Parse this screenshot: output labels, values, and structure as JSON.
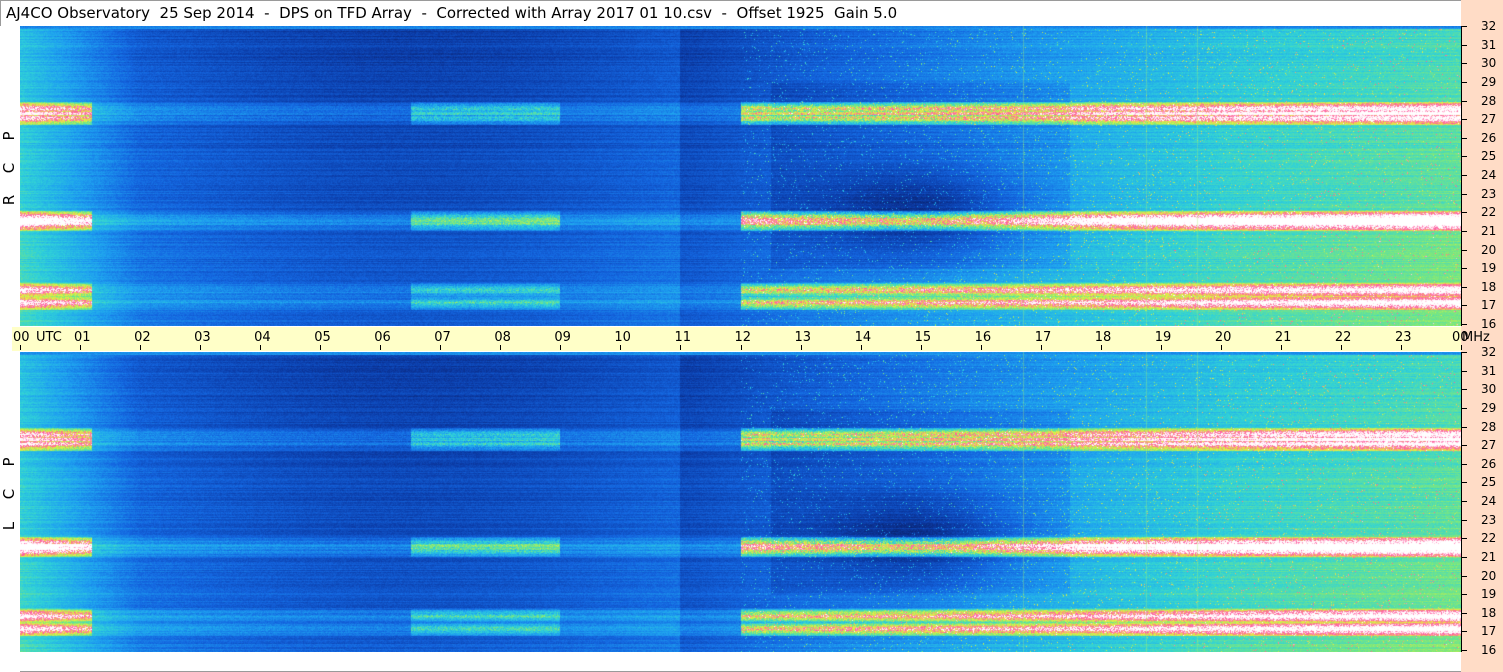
{
  "title": "AJ4CO Observatory  25 Sep 2014  -  DPS on TFD Array  -  Corrected with Array 2017 01 10.csv  -  Offset 1925  Gain 5.0",
  "chart_data": [
    {
      "type": "heatmap",
      "name": "RCP",
      "polarization_label": [
        "R",
        "C",
        "P"
      ],
      "x": {
        "label": "UTC",
        "ticks": [
          "00",
          "01",
          "02",
          "03",
          "04",
          "05",
          "06",
          "07",
          "08",
          "09",
          "10",
          "11",
          "12",
          "13",
          "14",
          "15",
          "16",
          "17",
          "18",
          "19",
          "20",
          "21",
          "22",
          "23",
          "00"
        ],
        "range": [
          0,
          24
        ]
      },
      "y": {
        "label": "MHz",
        "ticks": [
          "16",
          "17",
          "18",
          "19",
          "20",
          "21",
          "22",
          "23",
          "24",
          "25",
          "26",
          "27",
          "28",
          "29",
          "30",
          "31",
          "32"
        ],
        "range": [
          16,
          32
        ]
      },
      "colormap": [
        "#0a1a5a",
        "#0b3ca8",
        "#1466e0",
        "#1ea0f0",
        "#30d2d8",
        "#7fe87a",
        "#e8f040",
        "#ff5aa0",
        "#ffffff"
      ],
      "bright_bands_mhz": [
        17.2,
        17.9,
        21.4,
        21.8,
        27.1,
        27.6
      ],
      "quiet_period_utc": [
        2,
        11
      ],
      "dark_absorption_center": {
        "utc": 15,
        "mhz": 22
      }
    },
    {
      "type": "heatmap",
      "name": "LCP",
      "polarization_label": [
        "L",
        "C",
        "P"
      ],
      "x": {
        "label": "UTC",
        "range": [
          0,
          24
        ]
      },
      "y": {
        "label": "MHz",
        "ticks": [
          "16",
          "17",
          "18",
          "19",
          "20",
          "21",
          "22",
          "23",
          "24",
          "25",
          "26",
          "27",
          "28",
          "29",
          "30",
          "31",
          "32"
        ],
        "range": [
          16,
          32
        ]
      },
      "bright_bands_mhz": [
        17.2,
        17.9,
        21.4,
        21.8,
        27.1,
        27.6
      ],
      "quiet_period_utc": [
        2,
        11
      ],
      "dark_absorption_center": {
        "utc": 15,
        "mhz": 22
      }
    }
  ],
  "time_axis": {
    "labels": [
      "00",
      "UTC",
      "01",
      "02",
      "03",
      "04",
      "05",
      "06",
      "07",
      "08",
      "09",
      "10",
      "11",
      "12",
      "13",
      "14",
      "15",
      "16",
      "17",
      "18",
      "19",
      "20",
      "21",
      "22",
      "23",
      "00",
      "MHz"
    ]
  },
  "colors": {
    "background": "#ffffff",
    "time_bar": "#ffffc8",
    "right_axis_bg": "#ffdcc6"
  }
}
